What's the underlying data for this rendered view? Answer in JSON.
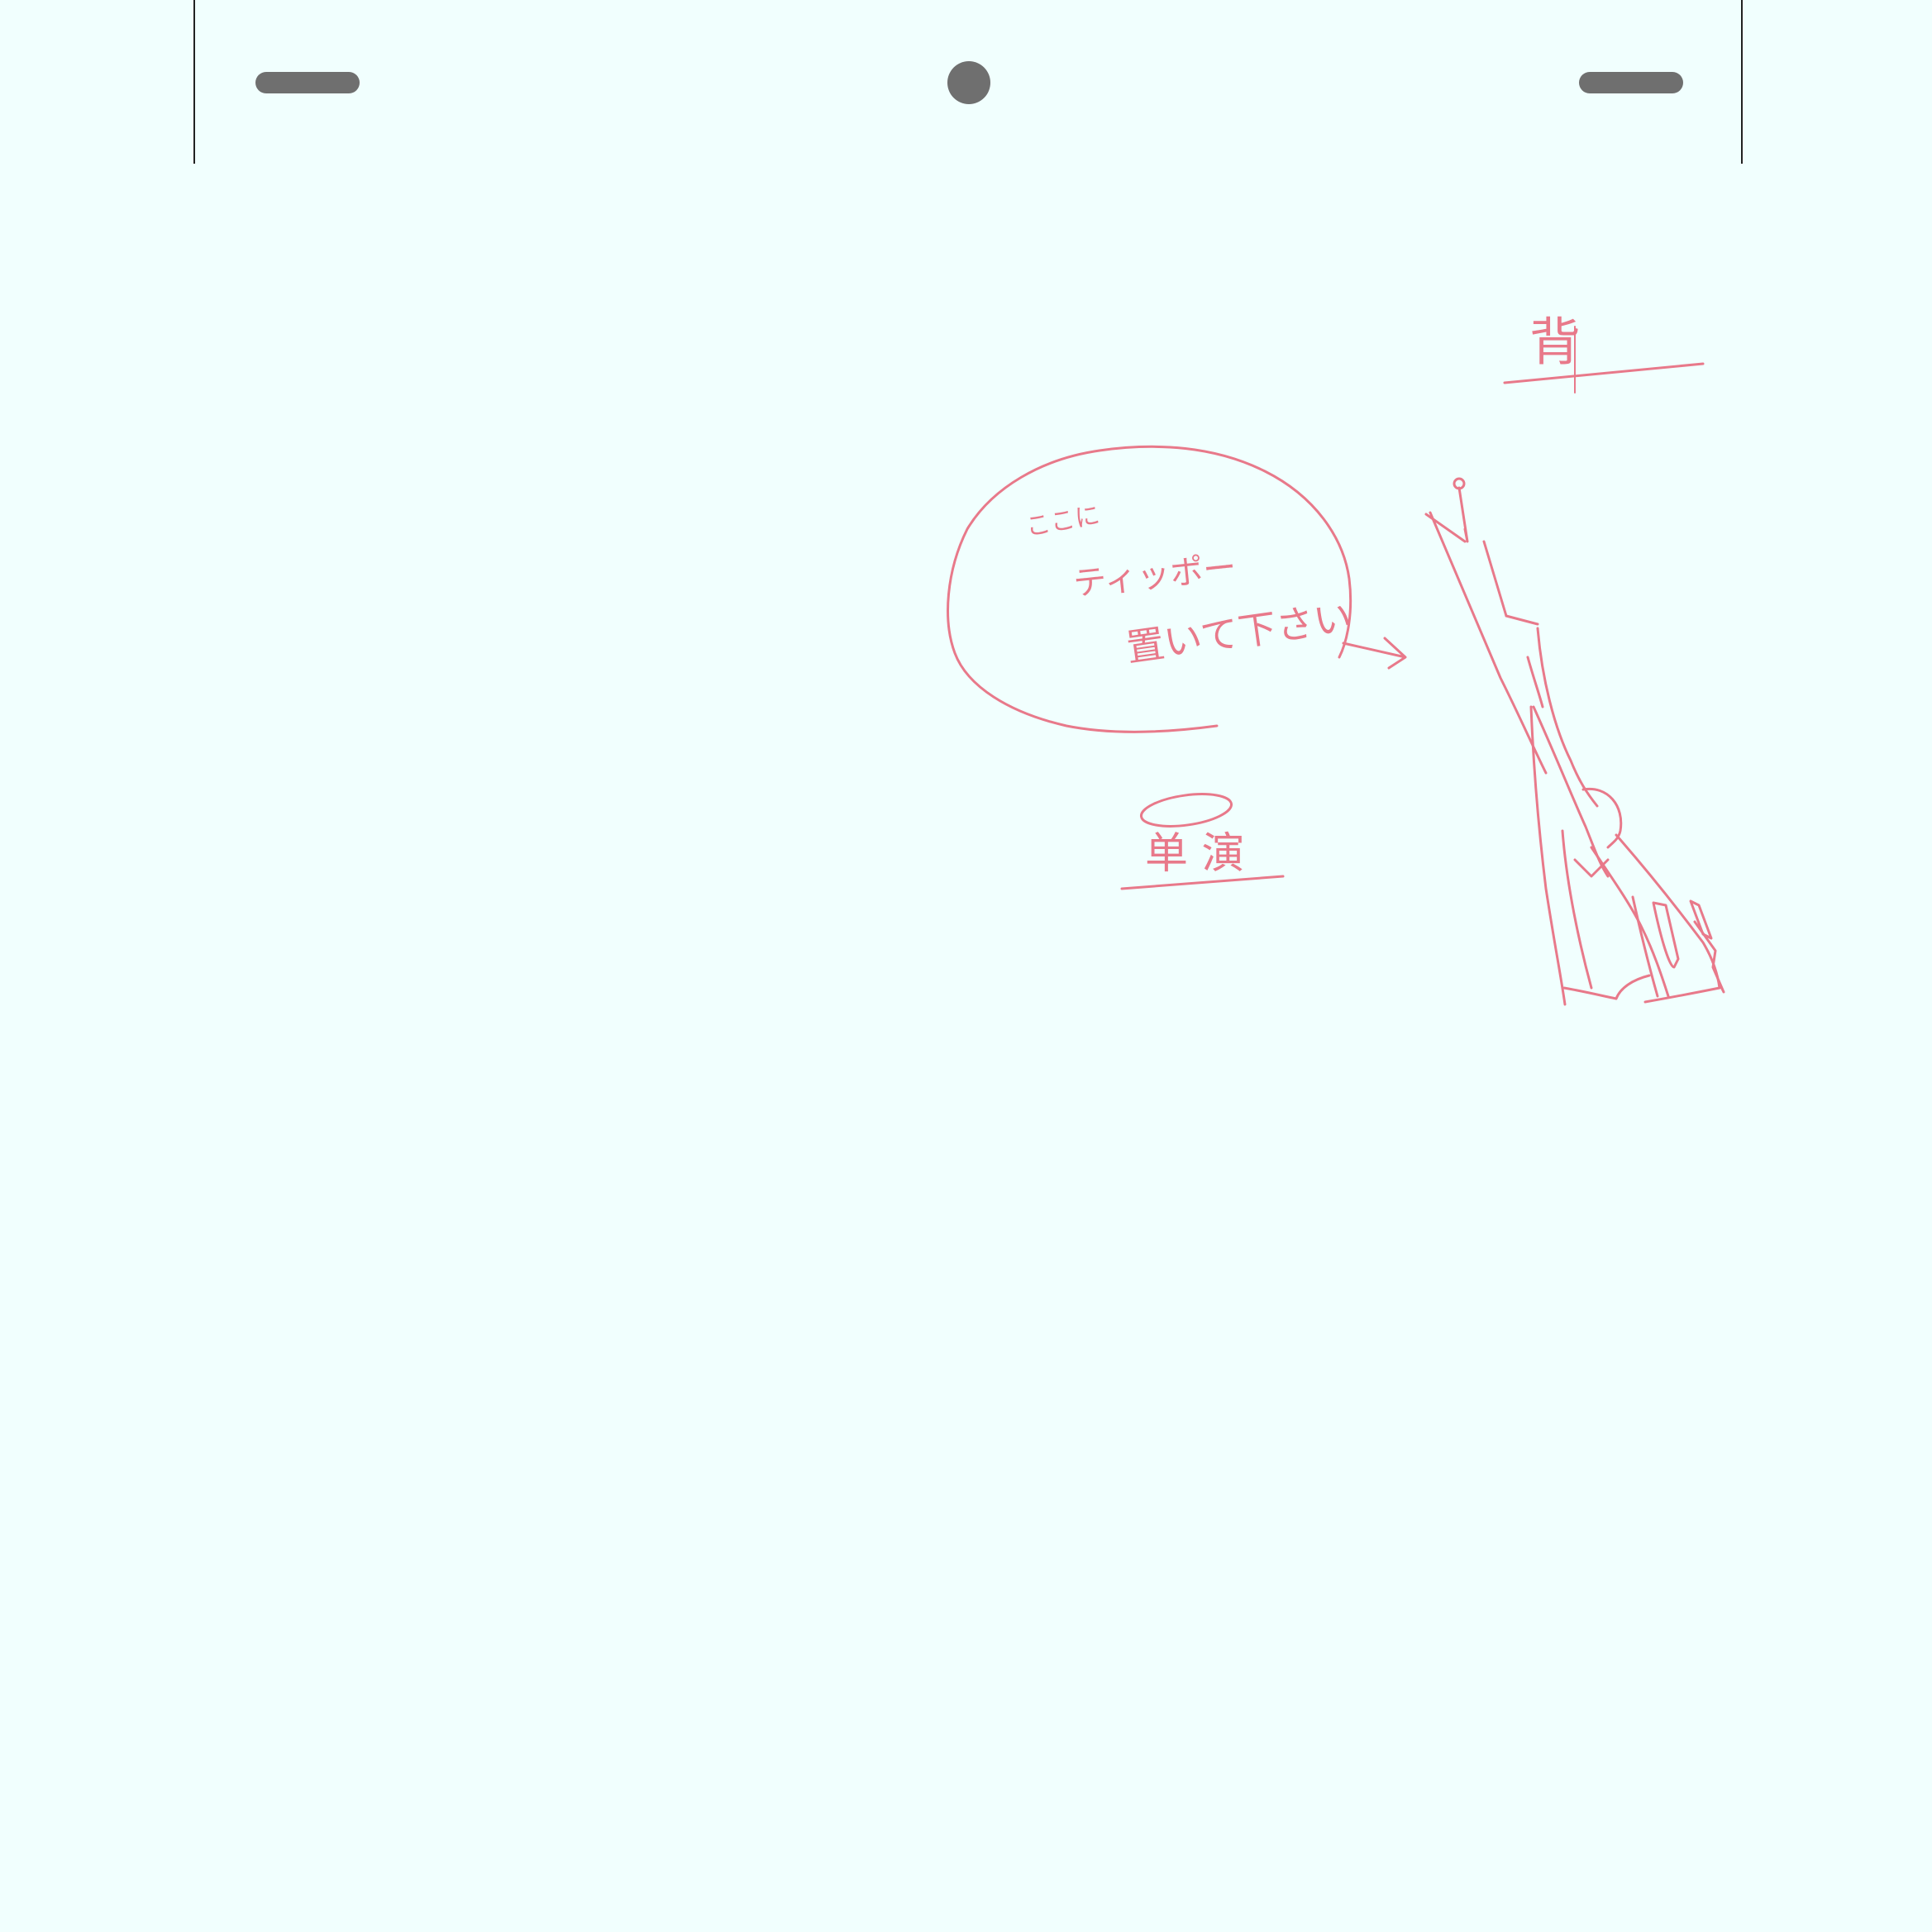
{
  "paper": {
    "background_color": "#f1fffe",
    "peg_color": "#6f6f6f",
    "frame_line_color": "#222222"
  },
  "sketch": {
    "ink_color": "#e8798a",
    "speech_bubble_text": [
      "ここに",
      "ティッポー",
      "置いて下さい"
    ],
    "label_top_right": "背",
    "label_bottom": "单 演"
  }
}
